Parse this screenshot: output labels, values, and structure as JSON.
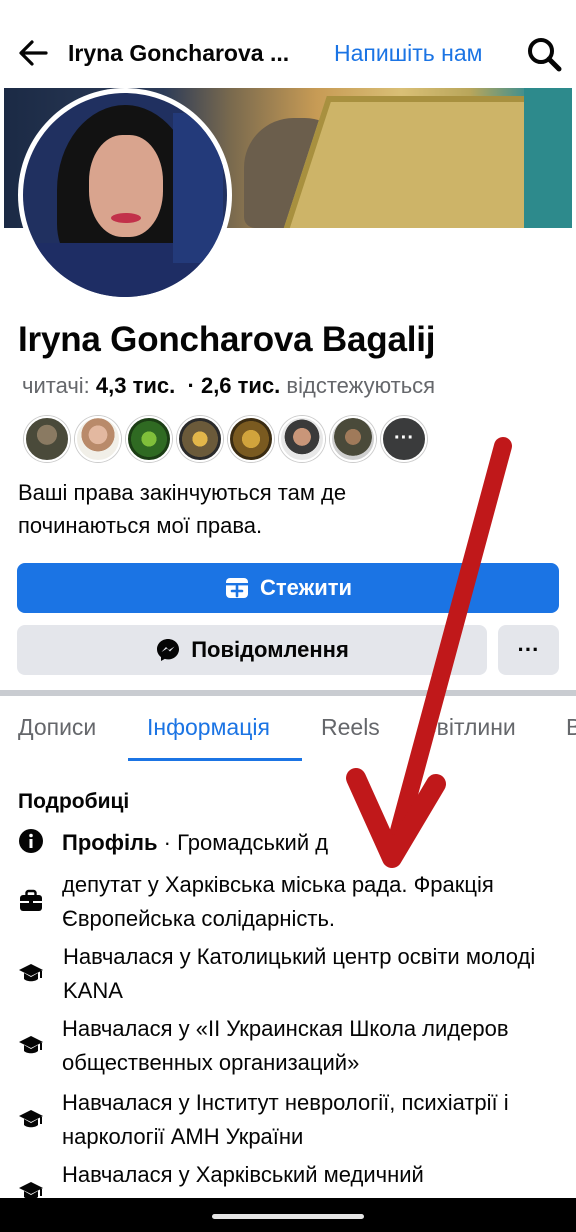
{
  "topbar": {
    "title": "Iryna Goncharova ...",
    "contact_link": "Напишіть нам",
    "back_icon": "back-arrow-icon",
    "search_icon": "search-icon"
  },
  "profile": {
    "name": "Iryna Goncharova Bagalij",
    "followers_label": "читачі:",
    "followers_count": "4,3 тис.",
    "separator": "·",
    "following_count": "2,6 тис.",
    "following_label": "відстежуються",
    "bio": "Ваші права закінчуються там де починаються мої права."
  },
  "buttons": {
    "follow": "Стежити",
    "message": "Повідомлення",
    "more": "···"
  },
  "friends_more": "···",
  "tabs": [
    {
      "label": "Дописи",
      "active": false
    },
    {
      "label": "Інформація",
      "active": true
    },
    {
      "label": "Reels",
      "active": false
    },
    {
      "label": "Світлини",
      "active": false
    },
    {
      "label": "В",
      "active": false
    }
  ],
  "details": {
    "title": "Подробиці",
    "items": [
      {
        "icon": "info-icon",
        "bold": "Профіль",
        "text": " · Громадський д"
      },
      {
        "icon": "briefcase-icon",
        "text": "депутат у Харківська міська рада. Фракція Європейська солідарність."
      },
      {
        "icon": "graduation-cap-icon",
        "text": "Навчалася у Католицький центр освіти молоді KANA"
      },
      {
        "icon": "graduation-cap-icon",
        "text": "Навчалася у «II Украинская Школа лидеров общественных организаций»"
      },
      {
        "icon": "graduation-cap-icon",
        "text": "Навчалася у Інститут неврології, психіатрії і наркології АМН України"
      },
      {
        "icon": "graduation-cap-icon",
        "text": "Навчалася у Харківський медичний"
      }
    ]
  },
  "colors": {
    "accent": "#1b74e4",
    "secondary_button": "#e4e6eb",
    "muted_text": "#65676b",
    "annotation_arrow": "#c0181a"
  }
}
